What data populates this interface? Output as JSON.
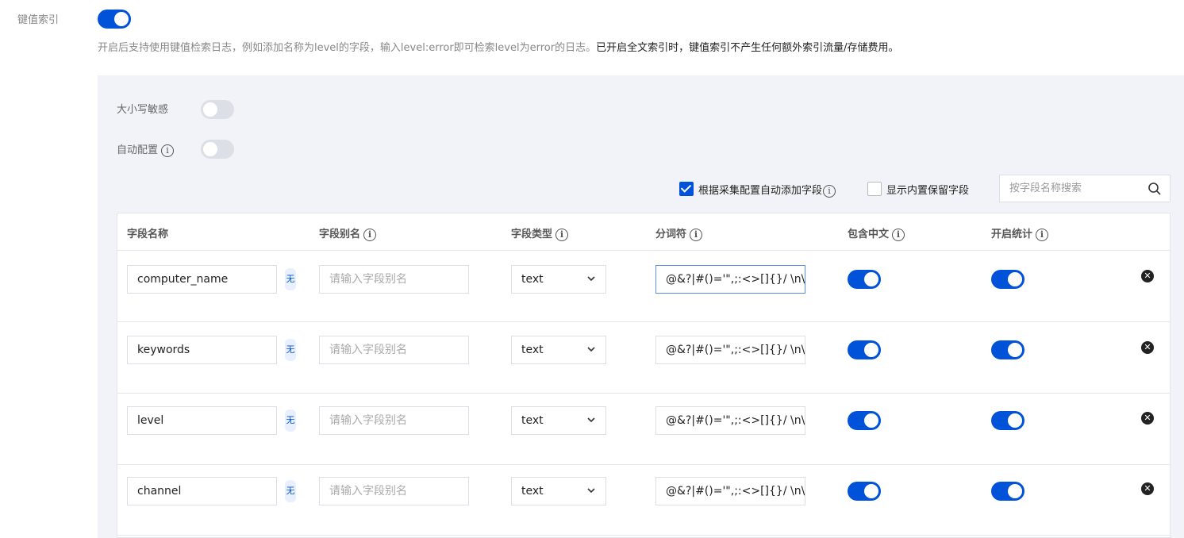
{
  "kv_index": {
    "label": "键值索引",
    "enabled": true,
    "description_normal": "开启后支持使用键值检索日志，例如添加名称为level的字段，输入level:error即可检索level为error的日志。",
    "description_strong": "已开启全文索引时，键值索引不产生任何额外索引流量/存储费用。"
  },
  "options": {
    "case_sensitive_label": "大小写敏感",
    "case_sensitive": false,
    "auto_config_label": "自动配置",
    "auto_config": false
  },
  "toolbar": {
    "auto_add_label": "根据采集配置自动添加字段",
    "auto_add_checked": true,
    "show_builtin_label": "显示内置保留字段",
    "show_builtin_checked": false,
    "search_placeholder": "按字段名称搜索"
  },
  "table": {
    "headers": {
      "field_name": "字段名称",
      "field_alias": "字段别名",
      "field_type": "字段类型",
      "tokenizer": "分词符",
      "chinese": "包含中文",
      "stats": "开启统计"
    },
    "alias_placeholder": "请输入字段别名",
    "tag_char": "无",
    "rows": [
      {
        "name": "computer_name",
        "type": "text",
        "tokenizer": "@&?|#()='\",;:<>[]{}/ \\n\\t\\r\\\\",
        "chinese": true,
        "stats": true
      },
      {
        "name": "keywords",
        "type": "text",
        "tokenizer": "@&?|#()='\",;:<>[]{}/ \\n\\t\\r\\\\",
        "chinese": true,
        "stats": true
      },
      {
        "name": "level",
        "type": "text",
        "tokenizer": "@&?|#()='\",;:<>[]{}/ \\n\\t\\r\\\\",
        "chinese": true,
        "stats": true
      },
      {
        "name": "channel",
        "type": "text",
        "tokenizer": "@&?|#()='\",;:<>[]{}/ \\n\\t\\r\\\\",
        "chinese": true,
        "stats": true
      }
    ]
  },
  "colors": {
    "primary": "#0052d9",
    "panel_bg": "#f2f3f8"
  }
}
